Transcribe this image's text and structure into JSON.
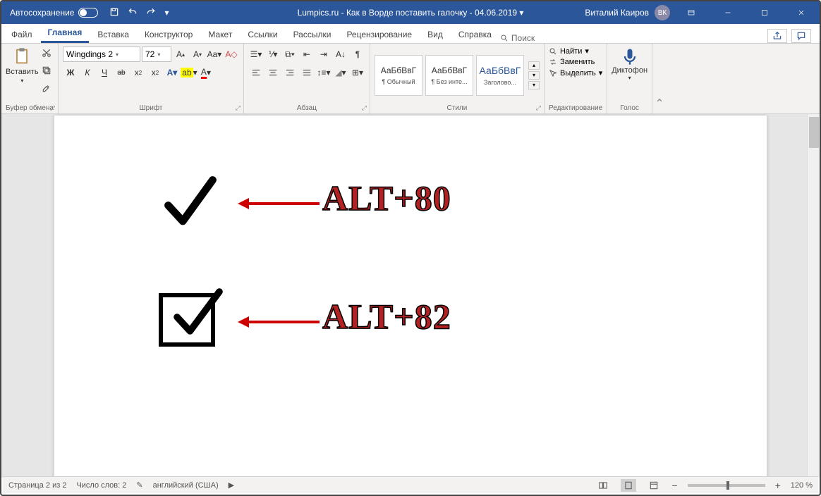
{
  "titlebar": {
    "autosave": "Автосохранение",
    "title": "Lumpics.ru - Как в Ворде поставить галочку - 04.06.2019 ▾",
    "user": "Виталий Каиров",
    "initials": "ВК"
  },
  "tabs": {
    "file": "Файл",
    "home": "Главная",
    "insert": "Вставка",
    "design": "Конструктор",
    "layout": "Макет",
    "references": "Ссылки",
    "mailings": "Рассылки",
    "review": "Рецензирование",
    "view": "Вид",
    "help": "Справка",
    "search": "Поиск"
  },
  "ribbon": {
    "clipboard": {
      "paste": "Вставить",
      "label": "Буфер обмена"
    },
    "font": {
      "name": "Wingdings 2",
      "size": "72",
      "bold": "Ж",
      "italic": "К",
      "underline": "Ч",
      "strike": "ab",
      "sub": "x₂",
      "sup": "x²",
      "label": "Шрифт"
    },
    "paragraph": {
      "label": "Абзац"
    },
    "styles": {
      "preview": "АаБбВвГ",
      "normal": "¶ Обычный",
      "nospace": "¶ Без инте...",
      "heading1": "Заголово...",
      "label": "Стили"
    },
    "editing": {
      "find": "Найти",
      "replace": "Заменить",
      "select": "Выделить",
      "label": "Редактирование"
    },
    "voice": {
      "dictate": "Диктофон",
      "label": "Голос"
    }
  },
  "document": {
    "annot1": "ALT+80",
    "annot2": "ALT+82"
  },
  "statusbar": {
    "page": "Страница 2 из 2",
    "words": "Число слов: 2",
    "lang": "английский (США)",
    "zoom": "120 %"
  }
}
